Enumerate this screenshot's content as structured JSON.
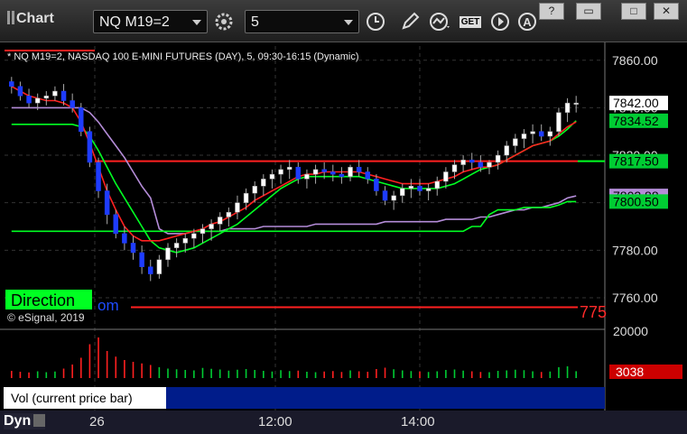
{
  "app": {
    "title": "Chart"
  },
  "toolbar": {
    "symbol_value": "NQ M19=2",
    "interval_value": "5",
    "icons": [
      "gear-icon",
      "clock-icon",
      "pencil-icon",
      "study-icon",
      "get-icon",
      "play-icon",
      "alert-icon"
    ],
    "get_label": "GET",
    "window_buttons": [
      "?",
      "▭",
      "□",
      "✕"
    ]
  },
  "chart": {
    "header": "* NQ M19=2, NASDAQ 100 E-MINI FUTURES (DAY), 5, 09:30-16:15 (Dynamic)",
    "copyright": "© eSignal, 2019",
    "direction_label": "Direction",
    "partial_om": "om",
    "partial_775": "775",
    "y_ticks": [
      "7860.00",
      "7840.00",
      "7820.00",
      "7800.00",
      "7780.00",
      "7760.00"
    ],
    "price_tags": [
      {
        "label": "7842.00",
        "bg": "#ffffff",
        "fg": "#000000"
      },
      {
        "label": "7834.52",
        "bg": "#00cc33",
        "fg": "#000000"
      },
      {
        "label": "7817.50",
        "bg": "#00cc33",
        "fg": "#000000"
      },
      {
        "label": "7802.88",
        "bg": "#b48cd8",
        "fg": "#000000"
      },
      {
        "label": "7800.50",
        "bg": "#00cc33",
        "fg": "#000000"
      }
    ],
    "vol_ticks": [
      "20000",
      "3038"
    ],
    "x_ticks": [
      "26",
      "12:00",
      "14:00"
    ],
    "volume_label": "Vol (current price bar)",
    "dyn_label": "Dyn"
  },
  "chart_data": {
    "type": "candlestick",
    "ylim": [
      7752,
      7866
    ],
    "ohlc": [
      [
        7851,
        7853,
        7846,
        7849
      ],
      [
        7849,
        7851,
        7843,
        7845
      ],
      [
        7845,
        7848,
        7840,
        7842
      ],
      [
        7842,
        7846,
        7839,
        7844
      ],
      [
        7844,
        7847,
        7841,
        7845
      ],
      [
        7845,
        7849,
        7843,
        7847
      ],
      [
        7847,
        7850,
        7841,
        7843
      ],
      [
        7843,
        7846,
        7838,
        7840
      ],
      [
        7840,
        7842,
        7828,
        7830
      ],
      [
        7830,
        7832,
        7815,
        7817
      ],
      [
        7817,
        7819,
        7802,
        7805
      ],
      [
        7805,
        7808,
        7791,
        7795
      ],
      [
        7795,
        7797,
        7785,
        7787
      ],
      [
        7787,
        7790,
        7780,
        7783
      ],
      [
        7783,
        7786,
        7776,
        7779
      ],
      [
        7779,
        7782,
        7770,
        7773
      ],
      [
        7773,
        7776,
        7767,
        7770
      ],
      [
        7770,
        7778,
        7768,
        7776
      ],
      [
        7776,
        7783,
        7773,
        7781
      ],
      [
        7781,
        7785,
        7777,
        7783
      ],
      [
        7783,
        7787,
        7779,
        7785
      ],
      [
        7785,
        7789,
        7781,
        7787
      ],
      [
        7787,
        7791,
        7783,
        7789
      ],
      [
        7789,
        7793,
        7784,
        7791
      ],
      [
        7791,
        7796,
        7788,
        7794
      ],
      [
        7794,
        7798,
        7790,
        7796
      ],
      [
        7796,
        7803,
        7793,
        7800
      ],
      [
        7800,
        7806,
        7797,
        7804
      ],
      [
        7804,
        7809,
        7800,
        7807
      ],
      [
        7807,
        7812,
        7803,
        7810
      ],
      [
        7810,
        7814,
        7806,
        7812
      ],
      [
        7812,
        7816,
        7808,
        7814
      ],
      [
        7814,
        7818,
        7810,
        7815
      ],
      [
        7815,
        7817,
        7808,
        7810
      ],
      [
        7810,
        7814,
        7806,
        7812
      ],
      [
        7812,
        7816,
        7808,
        7814
      ],
      [
        7814,
        7817,
        7810,
        7813
      ],
      [
        7813,
        7816,
        7809,
        7812
      ],
      [
        7812,
        7815,
        7808,
        7811
      ],
      [
        7811,
        7816,
        7809,
        7815
      ],
      [
        7815,
        7818,
        7811,
        7813
      ],
      [
        7813,
        7815,
        7808,
        7810
      ],
      [
        7810,
        7812,
        7803,
        7805
      ],
      [
        7805,
        7807,
        7799,
        7801
      ],
      [
        7801,
        7805,
        7797,
        7803
      ],
      [
        7803,
        7808,
        7800,
        7806
      ],
      [
        7806,
        7810,
        7802,
        7807
      ],
      [
        7807,
        7810,
        7803,
        7805
      ],
      [
        7805,
        7808,
        7801,
        7806
      ],
      [
        7806,
        7811,
        7803,
        7809
      ],
      [
        7809,
        7815,
        7806,
        7813
      ],
      [
        7813,
        7818,
        7810,
        7816
      ],
      [
        7816,
        7820,
        7813,
        7818
      ],
      [
        7818,
        7821,
        7814,
        7817
      ],
      [
        7817,
        7820,
        7813,
        7815
      ],
      [
        7815,
        7818,
        7812,
        7817
      ],
      [
        7817,
        7822,
        7814,
        7820
      ],
      [
        7820,
        7826,
        7817,
        7824
      ],
      [
        7824,
        7829,
        7821,
        7827
      ],
      [
        7827,
        7831,
        7823,
        7829
      ],
      [
        7829,
        7833,
        7825,
        7830
      ],
      [
        7830,
        7833,
        7826,
        7828
      ],
      [
        7828,
        7832,
        7824,
        7830
      ],
      [
        7830,
        7840,
        7828,
        7838
      ],
      [
        7838,
        7844,
        7834,
        7842
      ],
      [
        7842,
        7845,
        7838,
        7842
      ]
    ],
    "volume": [
      3200,
      2800,
      2500,
      3000,
      2600,
      2900,
      4200,
      6000,
      9000,
      15000,
      18000,
      12000,
      9500,
      8000,
      7200,
      6500,
      5800,
      4800,
      4200,
      3900,
      3600,
      3400,
      4500,
      4100,
      3800,
      3300,
      3700,
      4000,
      3600,
      3200,
      2900,
      3500,
      3100,
      3300,
      2800,
      2600,
      2900,
      3100,
      2700,
      3400,
      3000,
      2800,
      4000,
      4600,
      3900,
      3400,
      3100,
      2900,
      2700,
      3000,
      3600,
      3800,
      3300,
      3000,
      2700,
      2600,
      3200,
      3400,
      3700,
      3500,
      3000,
      2700,
      2900,
      4800,
      5200,
      3038
    ],
    "red_ma": [
      7849,
      7847,
      7845,
      7844,
      7843,
      7843,
      7842,
      7840,
      7834,
      7825,
      7815,
      7805,
      7797,
      7790,
      7786,
      7784,
      7784,
      7784,
      7785,
      7786,
      7787,
      7788,
      7789,
      7791,
      7792,
      7794,
      7796,
      7798,
      7801,
      7803,
      7805,
      7807,
      7809,
      7811,
      7812,
      7812,
      7813,
      7813,
      7813,
      7813,
      7813,
      7812,
      7811,
      7810,
      7809,
      7808,
      7808,
      7808,
      7808,
      7809,
      7810,
      7811,
      7813,
      7814,
      7815,
      7815,
      7816,
      7818,
      7820,
      7822,
      7824,
      7825,
      7826,
      7829,
      7832,
      7834
    ],
    "green_ma": [
      7833,
      7833,
      7833,
      7833,
      7833,
      7833,
      7833,
      7833,
      7832,
      7828,
      7822,
      7815,
      7808,
      7802,
      7796,
      7790,
      7784,
      7781,
      7780,
      7779,
      7780,
      7781,
      7783,
      7785,
      7787,
      7789,
      7791,
      7794,
      7797,
      7800,
      7803,
      7806,
      7808,
      7810,
      7811,
      7811,
      7811,
      7811,
      7811,
      7811,
      7811,
      7810,
      7809,
      7808,
      7807,
      7806,
      7806,
      7806,
      7806,
      7806,
      7807,
      7808,
      7810,
      7812,
      7814,
      7815,
      7816,
      7818,
      7820,
      7822,
      7824,
      7825,
      7826,
      7828,
      7831,
      7834.52
    ],
    "purple_ma": [
      7840,
      7840,
      7840,
      7840,
      7840,
      7840,
      7840,
      7840,
      7840,
      7838,
      7834,
      7829,
      7824,
      7819,
      7813,
      7807,
      7802,
      7789,
      7787,
      7787,
      7787,
      7788,
      7788,
      7788,
      7788,
      7789,
      7789,
      7789,
      7789,
      7790,
      7790,
      7790,
      7790,
      7790,
      7790,
      7791,
      7791,
      7791,
      7791,
      7791,
      7791,
      7791,
      7791,
      7792,
      7792,
      7792,
      7792,
      7792,
      7792,
      7792,
      7793,
      7793,
      7793,
      7793,
      7794,
      7794,
      7795,
      7796,
      7797,
      7797,
      7798,
      7798,
      7799,
      7800,
      7802,
      7802.88
    ],
    "green_step": [
      7788,
      7788,
      7788,
      7788,
      7788,
      7788,
      7788,
      7788,
      7788,
      7788,
      7788,
      7788,
      7788,
      7788,
      7788,
      7788,
      7788,
      7788,
      7788,
      7788,
      7788,
      7788,
      7788,
      7788,
      7788,
      7788,
      7788,
      7788,
      7788,
      7788,
      7788,
      7788,
      7788,
      7788,
      7788,
      7788,
      7788,
      7788,
      7788,
      7788,
      7788,
      7788,
      7788,
      7788,
      7788,
      7788,
      7788,
      7788,
      7788,
      7788,
      7788,
      7788,
      7788,
      7790,
      7790,
      7795,
      7797,
      7797,
      7797,
      7798,
      7798,
      7798,
      7798,
      7799,
      7800.5,
      7800.5
    ],
    "level_upper": 7817.5,
    "level_top": 7842,
    "level_bottom": 7756
  }
}
